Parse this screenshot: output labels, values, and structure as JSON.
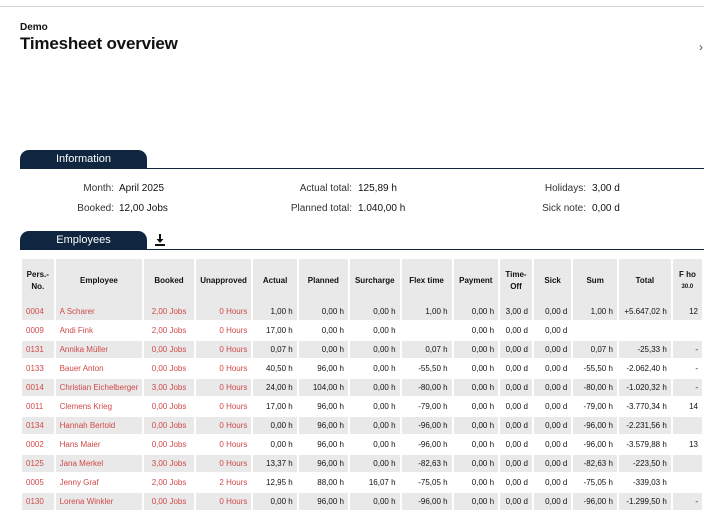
{
  "header": {
    "company": "Demo",
    "title": "Timesheet overview",
    "corner_glyph": "›"
  },
  "info": {
    "tab_label": "Information",
    "month_label": "Month:",
    "month_value": "April 2025",
    "booked_label": "Booked:",
    "booked_value": "12,00 Jobs",
    "actual_label": "Actual total:",
    "actual_value": "125,89 h",
    "planned_label": "Planned total:",
    "planned_value": "1.040,00 h",
    "holidays_label": "Holidays:",
    "holidays_value": "3,00 d",
    "sick_label": "Sick note:",
    "sick_value": "0,00 d"
  },
  "employees": {
    "tab_label": "Employees",
    "download_icon": "download-icon",
    "columns": [
      "Pers.-No.",
      "Employee",
      "Booked",
      "Unapproved",
      "Actual",
      "Planned",
      "Surcharge",
      "Flex time",
      "Payment",
      "Time-Off",
      "Sick",
      "Sum",
      "Total",
      "F ho"
    ],
    "partial_col_sub": "30.0",
    "rows": [
      {
        "no": "0004",
        "name": "A Scharer",
        "booked": "2,00 Jobs",
        "unapproved": "0 Hours",
        "actual": "1,00 h",
        "planned": "0,00 h",
        "surcharge": "0,00 h",
        "flex": "1,00 h",
        "payment": "0,00 h",
        "timeoff": "3,00 d",
        "sick": "0,00 d",
        "sum": "1,00 h",
        "total": "+5.647,02 h",
        "extra": "12"
      },
      {
        "no": "0009",
        "name": "Andi Fink",
        "booked": "2,00 Jobs",
        "unapproved": "0 Hours",
        "actual": "17,00 h",
        "planned": "0,00 h",
        "surcharge": "0,00 h",
        "flex": "",
        "payment": "0,00 h",
        "timeoff": "0,00 d",
        "sick": "0,00 d",
        "sum": "",
        "total": "",
        "extra": ""
      },
      {
        "no": "0131",
        "name": "Annika Müller",
        "booked": "0,00 Jobs",
        "unapproved": "0 Hours",
        "actual": "0,07 h",
        "planned": "0,00 h",
        "surcharge": "0,00 h",
        "flex": "0,07 h",
        "payment": "0,00 h",
        "timeoff": "0,00 d",
        "sick": "0,00 d",
        "sum": "0,07 h",
        "total": "-25,33 h",
        "extra": "-"
      },
      {
        "no": "0133",
        "name": "Bauer Anton",
        "booked": "0,00 Jobs",
        "unapproved": "0 Hours",
        "actual": "40,50 h",
        "planned": "96,00 h",
        "surcharge": "0,00 h",
        "flex": "-55,50 h",
        "payment": "0,00 h",
        "timeoff": "0,00 d",
        "sick": "0,00 d",
        "sum": "-55,50 h",
        "total": "-2.062,40 h",
        "extra": "-"
      },
      {
        "no": "0014",
        "name": "Christian Eichelberger",
        "booked": "3,00 Jobs",
        "unapproved": "0 Hours",
        "actual": "24,00 h",
        "planned": "104,00 h",
        "surcharge": "0,00 h",
        "flex": "-80,00 h",
        "payment": "0,00 h",
        "timeoff": "0,00 d",
        "sick": "0,00 d",
        "sum": "-80,00 h",
        "total": "-1.020,32 h",
        "extra": "-"
      },
      {
        "no": "0011",
        "name": "Clemens Krieg",
        "booked": "0,00 Jobs",
        "unapproved": "0 Hours",
        "actual": "17,00 h",
        "planned": "96,00 h",
        "surcharge": "0,00 h",
        "flex": "-79,00 h",
        "payment": "0,00 h",
        "timeoff": "0,00 d",
        "sick": "0,00 d",
        "sum": "-79,00 h",
        "total": "-3.770,34 h",
        "extra": "14"
      },
      {
        "no": "0134",
        "name": "Hannah Bertold",
        "booked": "0,00 Jobs",
        "unapproved": "0 Hours",
        "actual": "0,00 h",
        "planned": "96,00 h",
        "surcharge": "0,00 h",
        "flex": "-96,00 h",
        "payment": "0,00 h",
        "timeoff": "0,00 d",
        "sick": "0,00 d",
        "sum": "-96,00 h",
        "total": "-2.231,56 h",
        "extra": ""
      },
      {
        "no": "0002",
        "name": "Hans Maier",
        "booked": "0,00 Jobs",
        "unapproved": "0 Hours",
        "actual": "0,00 h",
        "planned": "96,00 h",
        "surcharge": "0,00 h",
        "flex": "-96,00 h",
        "payment": "0,00 h",
        "timeoff": "0,00 d",
        "sick": "0,00 d",
        "sum": "-96,00 h",
        "total": "-3.579,88 h",
        "extra": "13"
      },
      {
        "no": "0125",
        "name": "Jana Merkel",
        "booked": "3,00 Jobs",
        "unapproved": "0 Hours",
        "actual": "13,37 h",
        "planned": "96,00 h",
        "surcharge": "0,00 h",
        "flex": "-82,63 h",
        "payment": "0,00 h",
        "timeoff": "0,00 d",
        "sick": "0,00 d",
        "sum": "-82,63 h",
        "total": "-223,50 h",
        "extra": ""
      },
      {
        "no": "0005",
        "name": "Jenny Graf",
        "booked": "2,00 Jobs",
        "unapproved": "2 Hours",
        "actual": "12,95 h",
        "planned": "88,00 h",
        "surcharge": "16,07 h",
        "flex": "-75,05 h",
        "payment": "0,00 h",
        "timeoff": "0,00 d",
        "sick": "0,00 d",
        "sum": "-75,05 h",
        "total": "-339,03 h",
        "extra": ""
      },
      {
        "no": "0130",
        "name": "Lorena Winkler",
        "booked": "0,00 Jobs",
        "unapproved": "0 Hours",
        "actual": "0,00 h",
        "planned": "96,00 h",
        "surcharge": "0,00 h",
        "flex": "-96,00 h",
        "payment": "0,00 h",
        "timeoff": "0,00 d",
        "sick": "0,00 d",
        "sum": "-96,00 h",
        "total": "-1.299,50 h",
        "extra": "-"
      }
    ]
  },
  "colors": {
    "navy": "#0f2540",
    "link_red": "#d04949",
    "row_gray": "#e9e9e9"
  }
}
